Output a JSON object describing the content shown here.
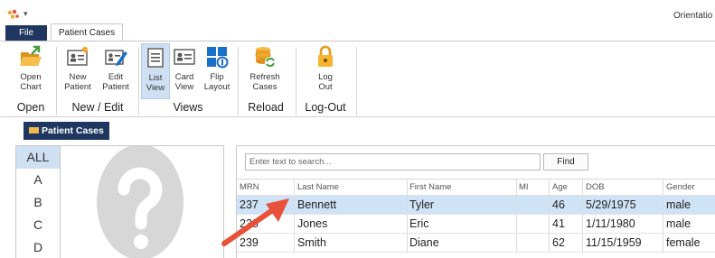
{
  "titlebar": {
    "window_title": "Orientatio",
    "quick_access_arrow": "▾",
    "logo_icon": "app-logo-icon"
  },
  "tabs": {
    "file": "File",
    "patient_cases": "Patient Cases"
  },
  "ribbon": {
    "open_chart": {
      "line1": "Open",
      "line2": "Chart",
      "icon": "folder-open-icon"
    },
    "new_patient": {
      "line1": "New",
      "line2": "Patient",
      "icon": "new-patient-icon"
    },
    "edit_patient": {
      "line1": "Edit",
      "line2": "Patient",
      "icon": "edit-patient-icon"
    },
    "list_view": {
      "line1": "List",
      "line2": "View",
      "icon": "list-view-icon"
    },
    "card_view": {
      "line1": "Card",
      "line2": "View",
      "icon": "card-view-icon"
    },
    "flip_layout": {
      "line1": "Flip",
      "line2": "Layout",
      "icon": "flip-layout-icon"
    },
    "refresh_cases": {
      "line1": "Refresh",
      "line2": "Cases",
      "icon": "refresh-database-icon"
    },
    "log_out": {
      "line1": "Log",
      "line2": "Out",
      "icon": "lock-icon"
    },
    "groups": {
      "open": "Open",
      "new_edit": "New / Edit",
      "views": "Views",
      "reload": "Reload",
      "logout": "Log-Out"
    }
  },
  "panel": {
    "title": "Patient Cases"
  },
  "alphabet": {
    "items": [
      "ALL",
      "A",
      "B",
      "C",
      "D"
    ],
    "selected": "ALL"
  },
  "search": {
    "placeholder": "Enter text to search...",
    "find_label": "Find"
  },
  "table": {
    "headers": {
      "mrn": "MRN",
      "last": "Last Name",
      "first": "First Name",
      "mi": "MI",
      "age": "Age",
      "dob": "DOB",
      "gender": "Gender"
    },
    "rows": [
      {
        "mrn": "237",
        "last": "Bennett",
        "first": "Tyler",
        "mi": "",
        "age": "46",
        "dob": "5/29/1975",
        "gender": "male",
        "selected": true
      },
      {
        "mrn": "238",
        "last": "Jones",
        "first": "Eric",
        "mi": "",
        "age": "41",
        "dob": "1/11/1980",
        "gender": "male",
        "selected": false
      },
      {
        "mrn": "239",
        "last": "Smith",
        "first": "Diane",
        "mi": "",
        "age": "62",
        "dob": "11/15/1959",
        "gender": "female",
        "selected": false
      }
    ]
  },
  "colors": {
    "navy": "#1f3760",
    "selection": "#cfe3f6",
    "annotation_arrow": "#e8503a",
    "accent_blue": "#1a6fc9",
    "accent_orange": "#f0a830"
  }
}
